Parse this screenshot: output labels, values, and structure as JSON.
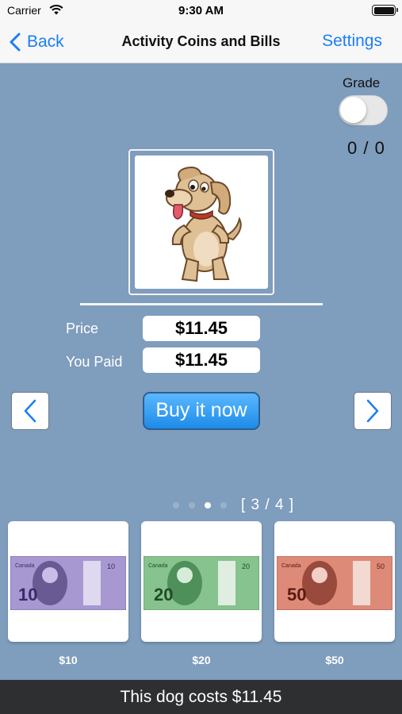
{
  "status_bar": {
    "carrier": "Carrier",
    "time": "9:30 AM"
  },
  "nav": {
    "back_label": "Back",
    "title": "Activity Coins and Bills",
    "settings_label": "Settings"
  },
  "grade": {
    "label": "Grade",
    "toggle_on": false,
    "score": "0 / 0"
  },
  "item": {
    "icon": "dog-image"
  },
  "price": {
    "price_label": "Price",
    "price_value": "$11.45",
    "paid_label": "You Paid",
    "paid_value": "$11.45"
  },
  "actions": {
    "buy_label": "Buy it now",
    "prev_icon": "chevron-left-icon",
    "next_icon": "chevron-right-icon"
  },
  "pager": {
    "dots": 4,
    "current": 3,
    "text": "[ 3 / 4 ]"
  },
  "bills": [
    {
      "label": "$10",
      "denomination": "10",
      "color": "#9d8dc9"
    },
    {
      "label": "$20",
      "denomination": "20",
      "color": "#7fc08a"
    },
    {
      "label": "$50",
      "denomination": "50",
      "color": "#d9806f"
    }
  ],
  "footer": {
    "message": "This dog costs $11.45"
  },
  "colors": {
    "background": "#7f9dbd",
    "accent": "#1a7ef5",
    "buy_button": "#2a95f0",
    "footer": "#2d2f31"
  }
}
